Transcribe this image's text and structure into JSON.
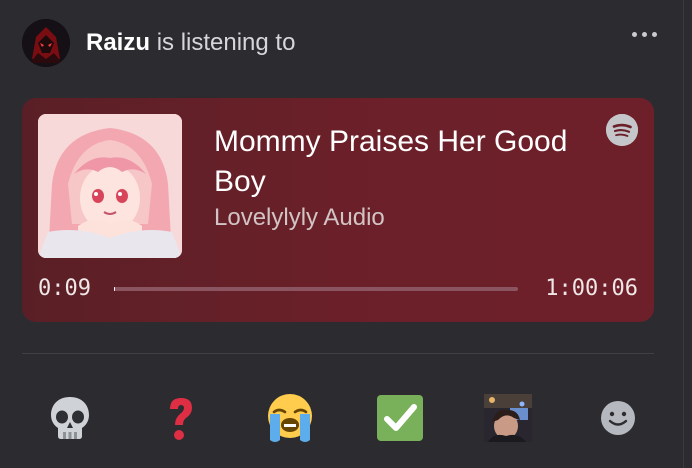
{
  "activity": {
    "username": "Raizu",
    "status_text": "is listening to"
  },
  "song": {
    "title": "Mommy Praises Her Good Boy",
    "artist": "Lovelylyly Audio",
    "elapsed": "0:09",
    "duration": "1:00:06",
    "progress_fraction": 0.0025,
    "service_icon": "spotify-icon"
  },
  "reactions": [
    {
      "name": "skull-emoji"
    },
    {
      "name": "question-mark-emoji"
    },
    {
      "name": "loudly-crying-face-emoji"
    },
    {
      "name": "white-check-mark-emoji"
    },
    {
      "name": "custom-photo-emoji"
    },
    {
      "name": "add-reaction-icon"
    }
  ],
  "colors": {
    "background": "#2b2b30",
    "card": "#6b2029",
    "accent_red": "#e0364f",
    "check_green": "#78b159"
  }
}
